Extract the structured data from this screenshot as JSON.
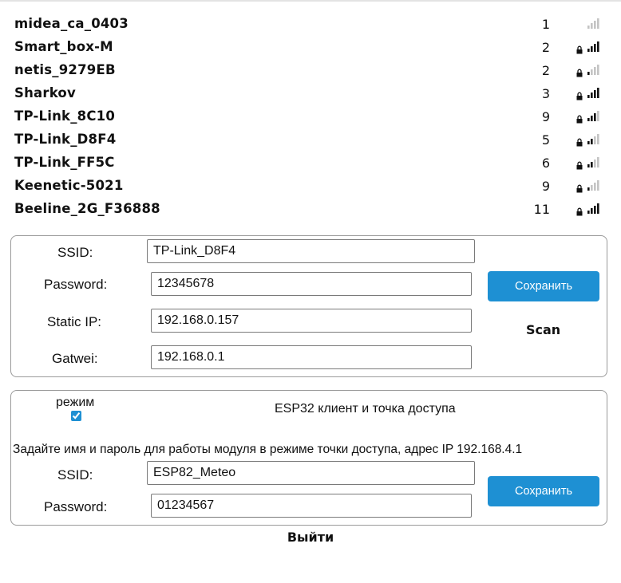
{
  "networks": [
    {
      "ssid": "midea_ca_0403",
      "channel": "1",
      "secured": false,
      "signal": 0
    },
    {
      "ssid": "Smart_box-M",
      "channel": "2",
      "secured": true,
      "signal": 4
    },
    {
      "ssid": "netis_9279EB",
      "channel": "2",
      "secured": true,
      "signal": 1
    },
    {
      "ssid": "Sharkov",
      "channel": "3",
      "secured": true,
      "signal": 4
    },
    {
      "ssid": "TP-Link_8C10",
      "channel": "9",
      "secured": true,
      "signal": 3
    },
    {
      "ssid": "TP-Link_D8F4",
      "channel": "5",
      "secured": true,
      "signal": 2
    },
    {
      "ssid": "TP-Link_FF5C",
      "channel": "6",
      "secured": true,
      "signal": 2
    },
    {
      "ssid": "Keenetic-5021",
      "channel": "9",
      "secured": true,
      "signal": 1
    },
    {
      "ssid": "Beeline_2G_F36888",
      "channel": "11",
      "secured": true,
      "signal": 4
    }
  ],
  "wifi_form": {
    "ssid_label": "SSID:",
    "ssid_value": "TP-Link_D8F4",
    "password_label": "Password:",
    "password_value": "12345678",
    "static_ip_label": "Static IP:",
    "static_ip_value": "192.168.0.157",
    "gateway_label": "Gatwei:",
    "gateway_value": "192.168.0.1",
    "save_label": "Сохранить",
    "scan_label": "Scan"
  },
  "ap_form": {
    "mode_label": "режим",
    "mode_checked": true,
    "mode_title": "ESP32 клиент и точка доступа",
    "hint": "Задайте имя и пароль для работы модуля в режиме точки доступа, адрес IP 192.168.4.1",
    "ssid_label": "SSID:",
    "ssid_value": "ESP82_Meteo",
    "password_label": "Password:",
    "password_value": "01234567",
    "save_label": "Сохранить"
  },
  "logout_label": "Выйти",
  "colors": {
    "button": "#1e90d3",
    "signal_active": "#111111",
    "signal_inactive": "#c4c4c4"
  }
}
